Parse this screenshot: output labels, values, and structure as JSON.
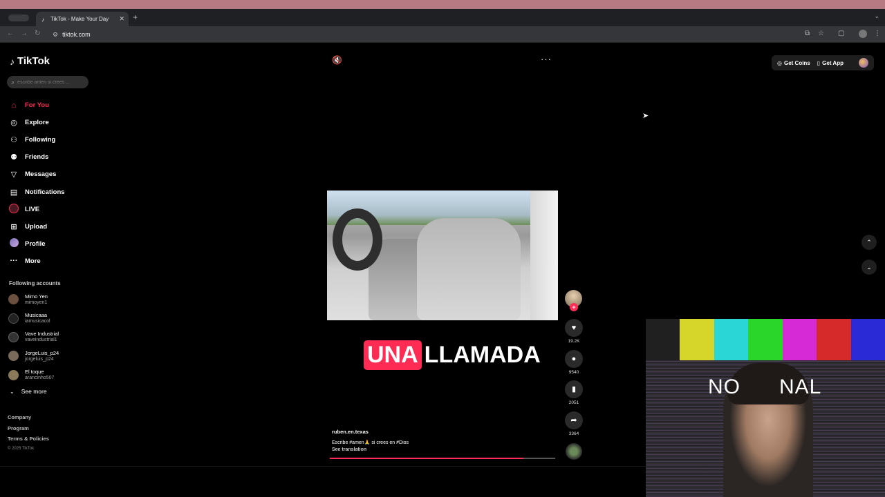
{
  "browser": {
    "tab_title": "TikTok - Make Your Day",
    "url": "tiktok.com"
  },
  "tiktok": {
    "logo": "TikTok",
    "search_placeholder": "escribe amen si crees ...",
    "nav": [
      {
        "label": "For You",
        "icon": "home-icon",
        "active": true
      },
      {
        "label": "Explore",
        "icon": "compass-icon"
      },
      {
        "label": "Following",
        "icon": "user-follow-icon"
      },
      {
        "label": "Friends",
        "icon": "friends-icon"
      },
      {
        "label": "Messages",
        "icon": "send-icon"
      },
      {
        "label": "Notifications",
        "icon": "inbox-icon"
      },
      {
        "label": "LIVE",
        "icon": "live-icon"
      },
      {
        "label": "Upload",
        "icon": "plus-square-icon"
      },
      {
        "label": "Profile",
        "icon": "profile-avatar"
      },
      {
        "label": "More",
        "icon": "more-dots-icon"
      }
    ],
    "following_title": "Following accounts",
    "accounts": [
      {
        "name": "Mimo Yen",
        "handle": "mimoyen1",
        "color": "#6b4f3f"
      },
      {
        "name": "Musicaaa",
        "handle": "iamusicacol",
        "color": "#222222"
      },
      {
        "name": "Vave Industrial",
        "handle": "vaveindustrial1",
        "color": "#333333"
      },
      {
        "name": "JorgeLuis_p24",
        "handle": "jorgeluis_p24",
        "color": "#7a6a5a"
      },
      {
        "name": "El toque",
        "handle": "arancinho507",
        "color": "#8a7a5a"
      }
    ],
    "see_more": "See more",
    "footer": [
      "Company",
      "Program",
      "Terms & Policies"
    ],
    "copyright": "© 2025 TikTok",
    "top_actions": {
      "coins": "Get Coins",
      "app": "Get App"
    },
    "video": {
      "caption_highlight": "UNA",
      "caption_rest": "LLAMADA",
      "author": "ruben.en.texas",
      "description": "Escribe #amen🙏 si crees en #Dios",
      "translate": "See translation",
      "progress": 0.86,
      "likes": "19.2K",
      "comments": "9540",
      "saves": "2051",
      "shares": "3364"
    },
    "webcam_overlay_text": "NO      NAL"
  }
}
